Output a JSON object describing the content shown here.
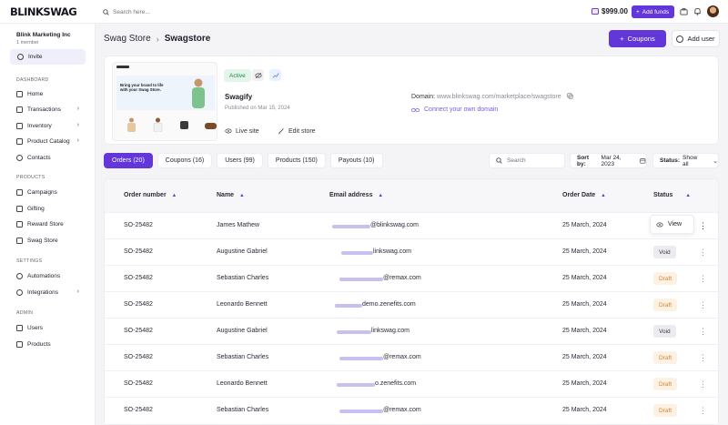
{
  "topbar": {
    "logo": "BLINKSWAG",
    "search_placeholder": "Search here...",
    "balance": "$999.00",
    "add_funds": "Add funds"
  },
  "sidebar": {
    "org_name": "Blink Marketing Inc",
    "org_sub": "1 member",
    "invite": "Invite",
    "sections": [
      {
        "title": "DASHBOARD",
        "items": [
          {
            "label": "Home",
            "icon": "home-icon"
          },
          {
            "label": "Transactions",
            "icon": "transactions-icon",
            "chevron": true
          },
          {
            "label": "Inventory",
            "icon": "inventory-icon",
            "chevron": true
          },
          {
            "label": "Product Catalog",
            "icon": "catalog-icon",
            "chevron": true
          },
          {
            "label": "Contacts",
            "icon": "contacts-icon"
          }
        ]
      },
      {
        "title": "PRODUCTS",
        "items": [
          {
            "label": "Campaigns",
            "icon": "campaigns-icon"
          },
          {
            "label": "Gifting",
            "icon": "gift-icon"
          },
          {
            "label": "Reward Store",
            "icon": "reward-icon"
          },
          {
            "label": "Swag Store",
            "icon": "store-icon"
          }
        ]
      },
      {
        "title": "SETTINGS",
        "items": [
          {
            "label": "Automations",
            "icon": "automations-icon"
          },
          {
            "label": "Integrations",
            "icon": "integrations-icon",
            "chevron": true
          }
        ]
      },
      {
        "title": "ADMIN",
        "items": [
          {
            "label": "Users",
            "icon": "users-icon"
          },
          {
            "label": "Products",
            "icon": "products-icon"
          }
        ]
      }
    ]
  },
  "header": {
    "breadcrumb_parent": "Swag Store",
    "breadcrumb_current": "Swagstore",
    "coupons_button": "Coupons",
    "add_user_button": "Add user"
  },
  "store": {
    "preview_headline": "Bring your brand to life with your Swag Store.",
    "status": "Active",
    "name": "Swagify",
    "published": "Published on Mar 15, 2024",
    "live_site": "Live site",
    "edit_store": "Edit store",
    "domain_label": "Domain:",
    "domain_value": "www.blinkswag.com/marketplace/swagstore",
    "connect_domain": "Connect your own domain"
  },
  "tabs": [
    {
      "label": "Orders (20)",
      "active": true
    },
    {
      "label": "Coupons (16)",
      "active": false
    },
    {
      "label": "Users (99)",
      "active": false
    },
    {
      "label": "Products (150)",
      "active": false
    },
    {
      "label": "Payouts (10)",
      "active": false
    }
  ],
  "filters": {
    "search_placeholder": "Search",
    "sort_label": "Sort by:",
    "sort_value": "Mar 24, 2023",
    "status_label": "Status:",
    "status_value": "Show all"
  },
  "table": {
    "columns": [
      "Order number",
      "Name",
      "Email address",
      "Order Date",
      "Status"
    ],
    "view_label": "View",
    "rows": [
      {
        "order": "SO-25482",
        "name": "James Mathew",
        "email": "@blinkswag.com",
        "date": "25 March, 2024",
        "status": "",
        "view": true
      },
      {
        "order": "SO-25482",
        "name": "Augustine Gabriel",
        "email": "linkswag.com",
        "date": "25 March, 2024",
        "status": "Void"
      },
      {
        "order": "SO-25482",
        "name": "Sebastian Charles",
        "email": "@remax.com",
        "date": "25 March, 2024",
        "status": "Draft"
      },
      {
        "order": "SO-25482",
        "name": "Leonardo Bennett",
        "email": "demo.zenefits.com",
        "date": "25 March, 2024",
        "status": "Draft"
      },
      {
        "order": "SO-25482",
        "name": "Augustine Gabriel",
        "email": "linkswag.com",
        "date": "25 March, 2024",
        "status": "Void"
      },
      {
        "order": "SO-25482",
        "name": "Sebastian Charles",
        "email": "@remax.com",
        "date": "25 March, 2024",
        "status": "Draft"
      },
      {
        "order": "SO-25482",
        "name": "Leonardo Bennett",
        "email": "o.zenefits.com",
        "date": "25 March, 2024",
        "status": "Draft"
      },
      {
        "order": "SO-25482",
        "name": "Sebastian Charles",
        "email": "@remax.com",
        "date": "25 March, 2024",
        "status": "Draft"
      }
    ]
  },
  "colors": {
    "accent": "#6236d9",
    "active_green": "#1f8a4c",
    "draft_orange": "#d9822b"
  }
}
